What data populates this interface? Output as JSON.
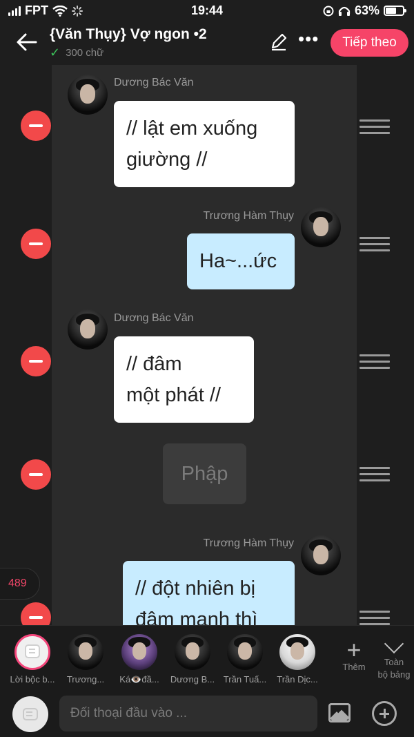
{
  "status": {
    "carrier": "FPT",
    "time": "19:44",
    "battery": "63%",
    "battery_level": 0.63
  },
  "header": {
    "title": "{Văn Thụy} Vợ ngon •2",
    "word_count": "300 chữ",
    "next_label": "Tiếp theo"
  },
  "messages": [
    {
      "speaker": "Dương Bác Văn",
      "side": "left",
      "text_line1": "// lật em xuống",
      "text_line2": "giường //"
    },
    {
      "speaker": "Trương Hàm Thụy",
      "side": "right",
      "text_line1": "Ha~...ức"
    },
    {
      "speaker": "Dương Bác Văn",
      "side": "left",
      "text_line1": "// đâm",
      "text_line2": "một phát //"
    },
    {
      "type": "narration",
      "text_line1": "Phập"
    },
    {
      "speaker": "Trương Hàm Thụy",
      "side": "right",
      "text_line1": "// đột nhiên bị",
      "text_line2": "đâm mạnh thì"
    }
  ],
  "counter": "489",
  "characters": [
    {
      "label": "Lời bộc b...",
      "selected": true
    },
    {
      "label": "Trương..."
    },
    {
      "label": "Ká👁️đầ..."
    },
    {
      "label": "Dương B..."
    },
    {
      "label": "Trần Tuấ..."
    },
    {
      "label": "Trần Dịc..."
    }
  ],
  "more_label": "Thêm",
  "all_label_line1": "Toàn",
  "all_label_line2": "bộ bảng",
  "input": {
    "placeholder": "Đối thoại đầu vào ..."
  },
  "colors": {
    "accent": "#f64468",
    "remove": "#f2494a",
    "blue_bubble": "#c8ecff"
  }
}
